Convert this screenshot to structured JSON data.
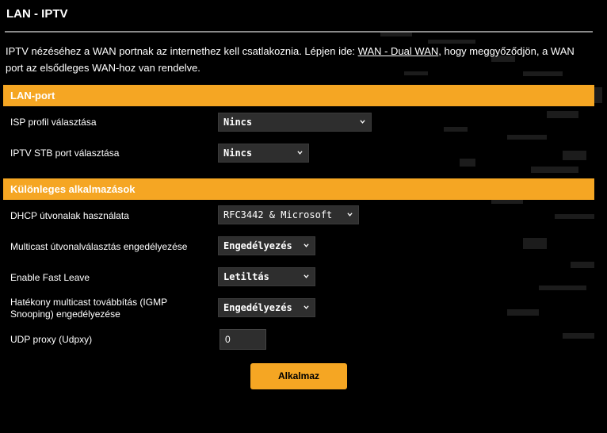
{
  "page": {
    "title": "LAN - IPTV",
    "desc_before": "IPTV nézéséhez a WAN portnak az internethez kell csatlakoznia. Lépjen ide: ",
    "desc_link": "WAN - Dual WAN",
    "desc_after": ", hogy meggyőződjön, a WAN port az elsődleges WAN-hoz van rendelve."
  },
  "lan_port": {
    "header": "LAN-port",
    "isp_label": "ISP profil választása",
    "isp_value": "Nincs",
    "stb_label": "IPTV STB port választása",
    "stb_value": "Nincs"
  },
  "special_apps": {
    "header": "Különleges alkalmazások",
    "dhcp_label": "DHCP útvonalak használata",
    "dhcp_value": "RFC3442 & Microsoft",
    "multicast_label": "Multicast útvonalválasztás engedélyezése",
    "multicast_value": "Engedélyezés",
    "fastleave_label": "Enable Fast Leave",
    "fastleave_value": "Letiltás",
    "igmp_label": "Hatékony multicast továbbítás (IGMP Snooping) engedélyezése",
    "igmp_value": "Engedélyezés",
    "udpxy_label": "UDP proxy (Udpxy)",
    "udpxy_value": "0"
  },
  "actions": {
    "apply_label": "Alkalmaz"
  },
  "colors": {
    "accent": "#f5a623",
    "background": "#000000",
    "field": "#2e2e2e"
  }
}
